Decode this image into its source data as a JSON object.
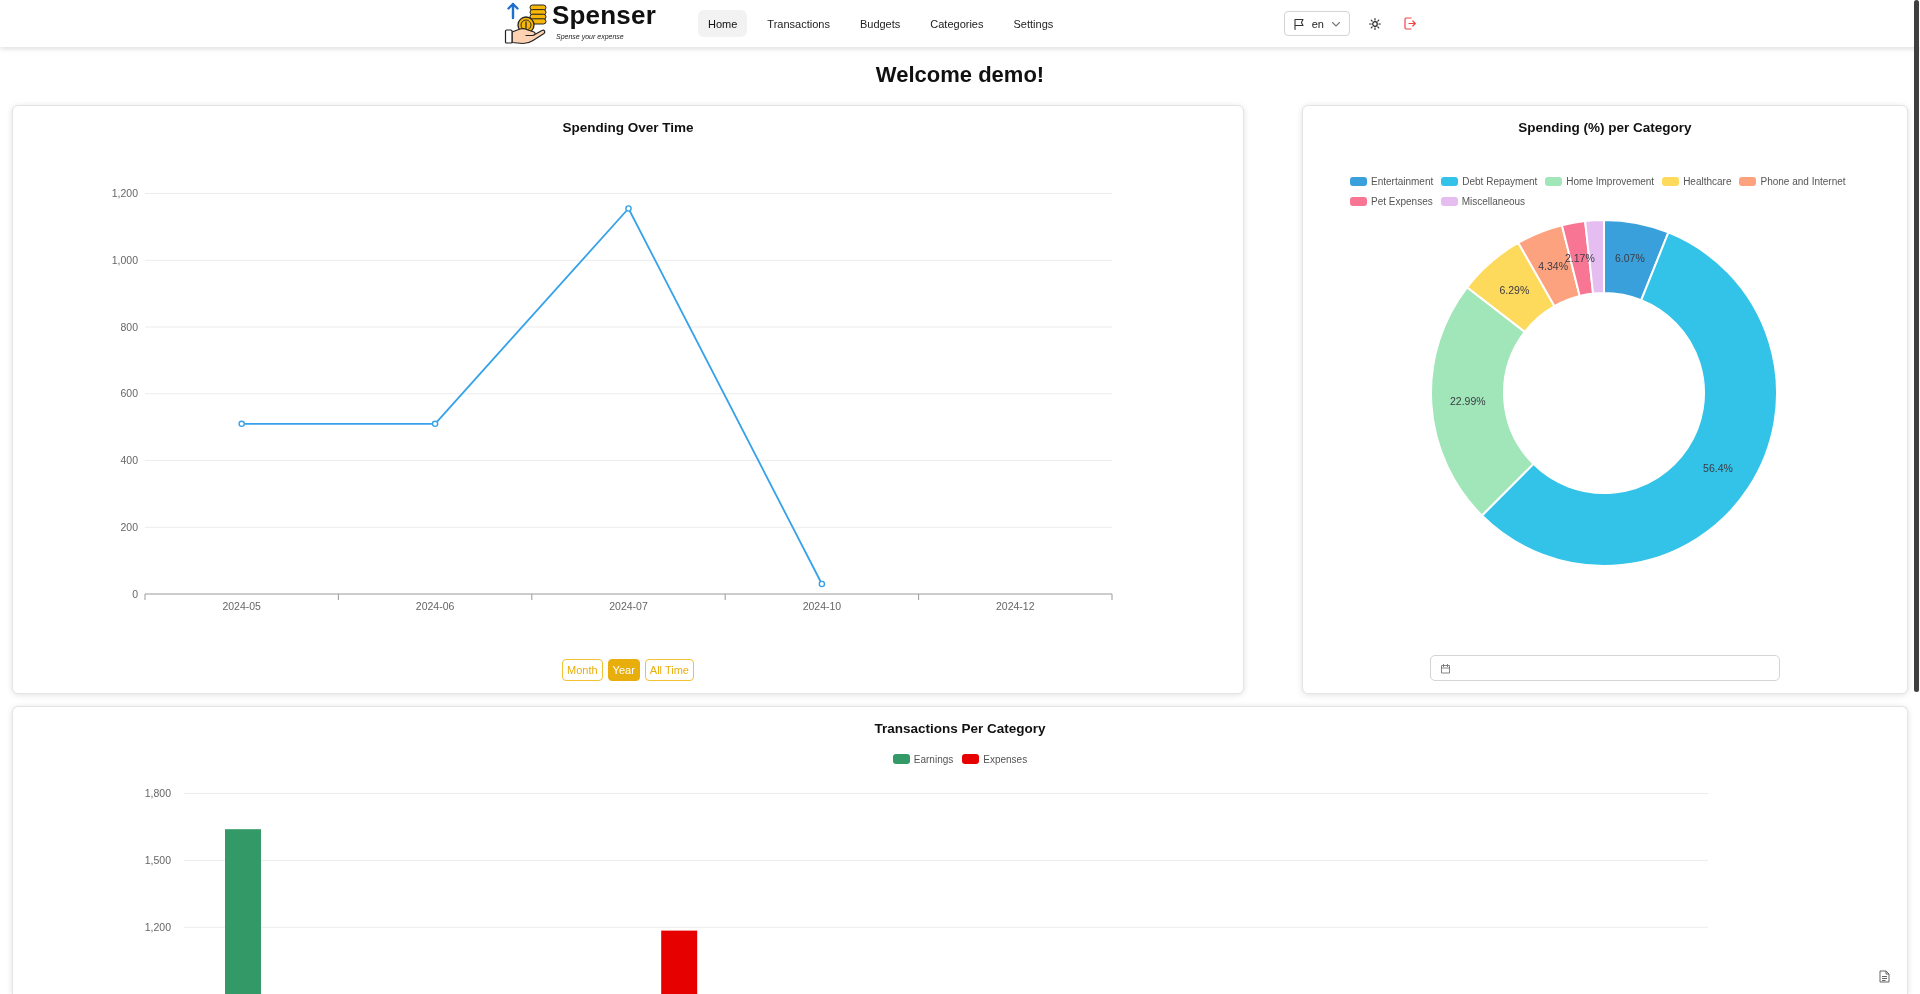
{
  "header": {
    "brand": {
      "name": "Spenser",
      "tagline": "Spense your expense"
    },
    "nav": [
      {
        "label": "Home",
        "selected": true
      },
      {
        "label": "Transactions",
        "selected": false
      },
      {
        "label": "Budgets",
        "selected": false
      },
      {
        "label": "Categories",
        "selected": false
      },
      {
        "label": "Settings",
        "selected": false
      }
    ],
    "language": "en"
  },
  "page": {
    "title": "Welcome demo!"
  },
  "spending_over_time": {
    "title": "Spending Over Time",
    "chart_data": {
      "type": "line",
      "categories": [
        "2024-05",
        "2024-06",
        "2024-07",
        "2024-10",
        "2024-12"
      ],
      "series": [
        {
          "color": "#36a2eb",
          "marker": true,
          "values": [
            510,
            510,
            1155,
            30,
            null
          ]
        }
      ],
      "ylim": [
        0,
        1200
      ],
      "yticks": [
        {
          "value": 0,
          "label": "0"
        },
        {
          "value": 200,
          "label": "200"
        },
        {
          "value": 400,
          "label": "400"
        },
        {
          "value": 600,
          "label": "600"
        },
        {
          "value": 800,
          "label": "800"
        },
        {
          "value": 1000,
          "label": "1,000"
        },
        {
          "value": 1200,
          "label": "1,200"
        }
      ],
      "grid": true
    },
    "ranges": [
      {
        "label": "Month",
        "selected": false
      },
      {
        "label": "Year",
        "selected": true
      },
      {
        "label": "All Time",
        "selected": false
      }
    ]
  },
  "spending_per_category": {
    "title": "Spending (%) per Category",
    "chart_data": {
      "type": "donut",
      "categories": [
        "Entertainment",
        "Debt Repayment",
        "Home Improvement",
        "Healthcare",
        "Phone and Internet",
        "Pet Expenses",
        "Miscellaneous"
      ],
      "series": [
        {
          "values": [
            6.07,
            56.4,
            22.99,
            6.29,
            4.34,
            2.17,
            1.74
          ],
          "colors": [
            "#3aa0dc",
            "#33c3e8",
            "#a0e6b9",
            "#fdd95c",
            "#fca27e",
            "#f87594",
            "#e6bdf1"
          ]
        }
      ],
      "value_labels": [
        "6.07%",
        "56.4%",
        "22.99%",
        "6.29%",
        "4.34%",
        "2.17%",
        null
      ]
    }
  },
  "transactions_per_category": {
    "title": "Transactions Per Category",
    "chart_data": {
      "type": "bar",
      "stacked": false,
      "series": [
        {
          "name": "Earnings",
          "color": "#339966",
          "values": [
            1640,
            null,
            null,
            null,
            null,
            null,
            null,
            null,
            null,
            null,
            null
          ]
        },
        {
          "name": "Expenses",
          "color": "#e60000",
          "values": [
            null,
            null,
            null,
            1185,
            null,
            null,
            null,
            null,
            null,
            null,
            null
          ]
        }
      ],
      "ylim": [
        900,
        1800
      ],
      "yticks": [
        {
          "value": 1200,
          "label": "1,200"
        },
        {
          "value": 1500,
          "label": "1,500"
        },
        {
          "value": 1800,
          "label": "1,800"
        }
      ],
      "grid": true
    }
  }
}
